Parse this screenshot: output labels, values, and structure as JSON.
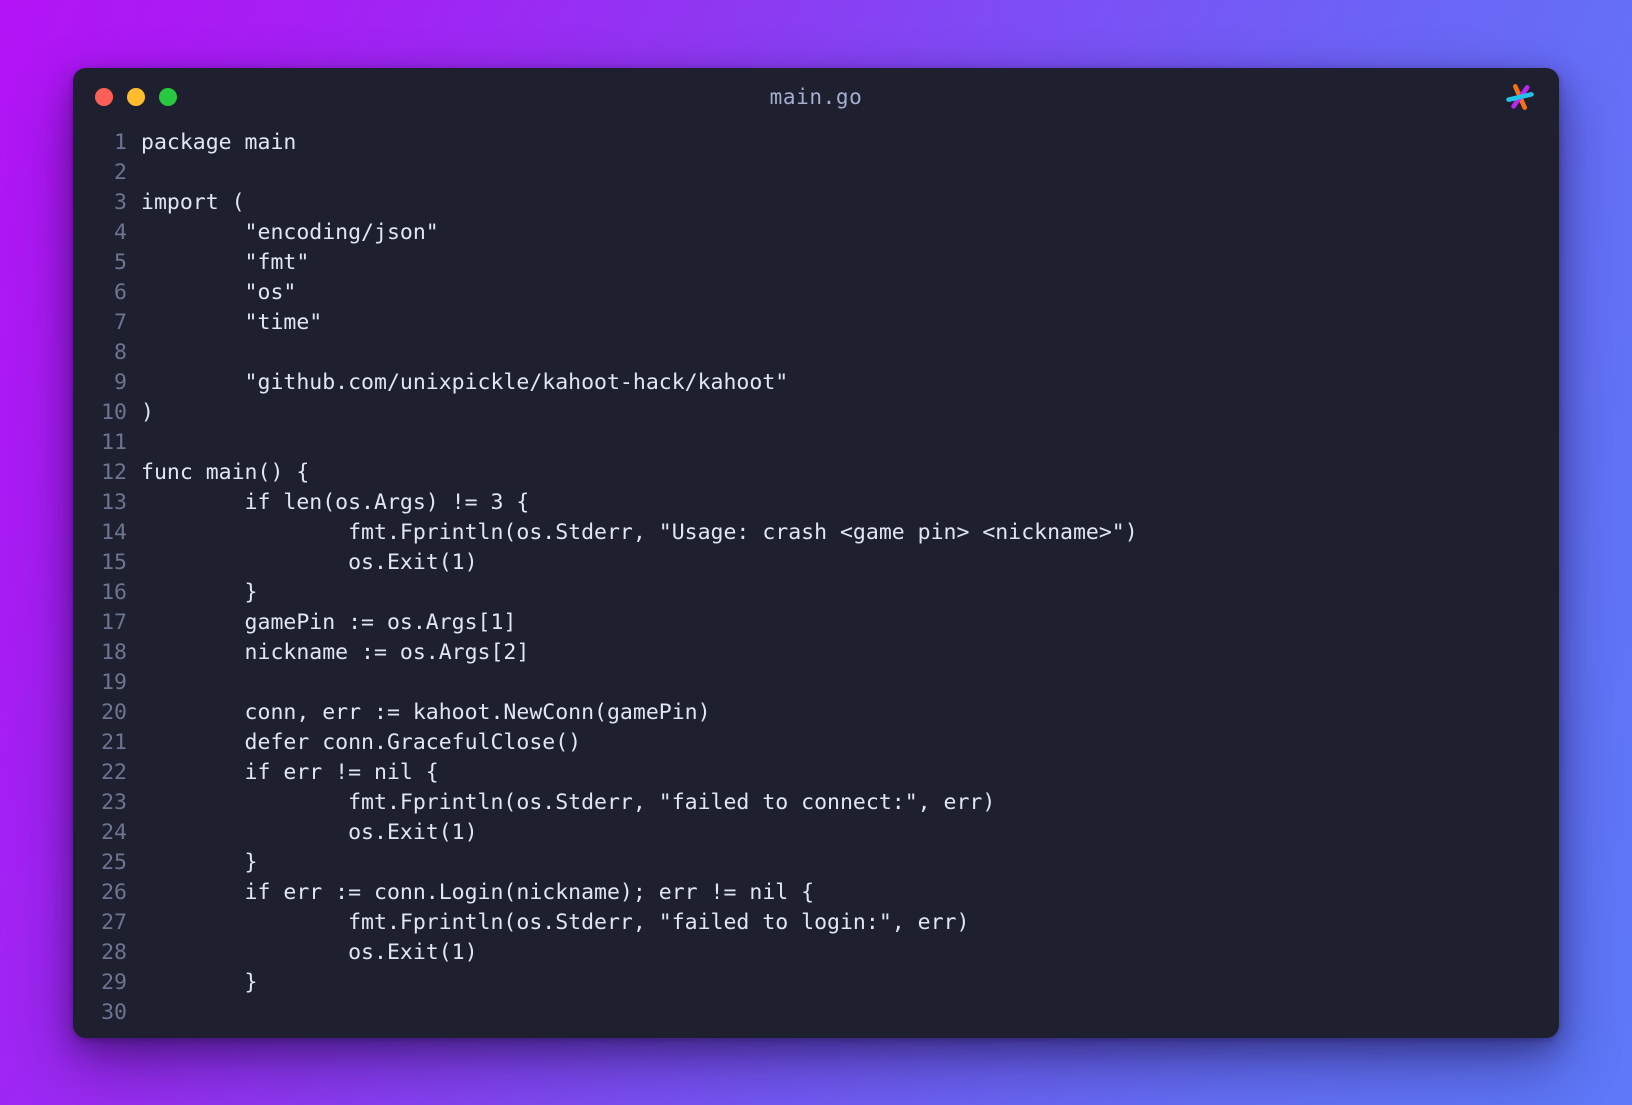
{
  "window": {
    "title": "main.go",
    "logo_icon": "asterisk-logo-icon",
    "background_gradient_from": "#b313f6",
    "background_gradient_to": "#5d78f8",
    "window_background": "#1e2030",
    "code_text_color": "#e2e6f2",
    "line_number_color": "#6e7591",
    "title_color": "#a6aed0"
  },
  "traffic_lights": [
    {
      "name": "close-button",
      "color": "#ff5f57",
      "label": "Close"
    },
    {
      "name": "minimize-button",
      "color": "#febc2e",
      "label": "Minimize"
    },
    {
      "name": "maximize-button",
      "color": "#28c840",
      "label": "Maximize"
    }
  ],
  "logo": {
    "stroke_orange": "#f97316",
    "stroke_magenta": "#b829ef",
    "stroke_cyan": "#22c3e6"
  },
  "editor": {
    "language": "go",
    "first_line": 1,
    "last_line": 30,
    "lines": [
      {
        "n": "1",
        "text": "package main"
      },
      {
        "n": "2",
        "text": ""
      },
      {
        "n": "3",
        "text": "import ("
      },
      {
        "n": "4",
        "text": "        \"encoding/json\""
      },
      {
        "n": "5",
        "text": "        \"fmt\""
      },
      {
        "n": "6",
        "text": "        \"os\""
      },
      {
        "n": "7",
        "text": "        \"time\""
      },
      {
        "n": "8",
        "text": ""
      },
      {
        "n": "9",
        "text": "        \"github.com/unixpickle/kahoot-hack/kahoot\""
      },
      {
        "n": "10",
        "text": ")"
      },
      {
        "n": "11",
        "text": ""
      },
      {
        "n": "12",
        "text": "func main() {"
      },
      {
        "n": "13",
        "text": "        if len(os.Args) != 3 {"
      },
      {
        "n": "14",
        "text": "                fmt.Fprintln(os.Stderr, \"Usage: crash <game pin> <nickname>\")"
      },
      {
        "n": "15",
        "text": "                os.Exit(1)"
      },
      {
        "n": "16",
        "text": "        }"
      },
      {
        "n": "17",
        "text": "        gamePin := os.Args[1]"
      },
      {
        "n": "18",
        "text": "        nickname := os.Args[2]"
      },
      {
        "n": "19",
        "text": ""
      },
      {
        "n": "20",
        "text": "        conn, err := kahoot.NewConn(gamePin)"
      },
      {
        "n": "21",
        "text": "        defer conn.GracefulClose()"
      },
      {
        "n": "22",
        "text": "        if err != nil {"
      },
      {
        "n": "23",
        "text": "                fmt.Fprintln(os.Stderr, \"failed to connect:\", err)"
      },
      {
        "n": "24",
        "text": "                os.Exit(1)"
      },
      {
        "n": "25",
        "text": "        }"
      },
      {
        "n": "26",
        "text": "        if err := conn.Login(nickname); err != nil {"
      },
      {
        "n": "27",
        "text": "                fmt.Fprintln(os.Stderr, \"failed to login:\", err)"
      },
      {
        "n": "28",
        "text": "                os.Exit(1)"
      },
      {
        "n": "29",
        "text": "        }"
      },
      {
        "n": "30",
        "text": ""
      }
    ]
  }
}
